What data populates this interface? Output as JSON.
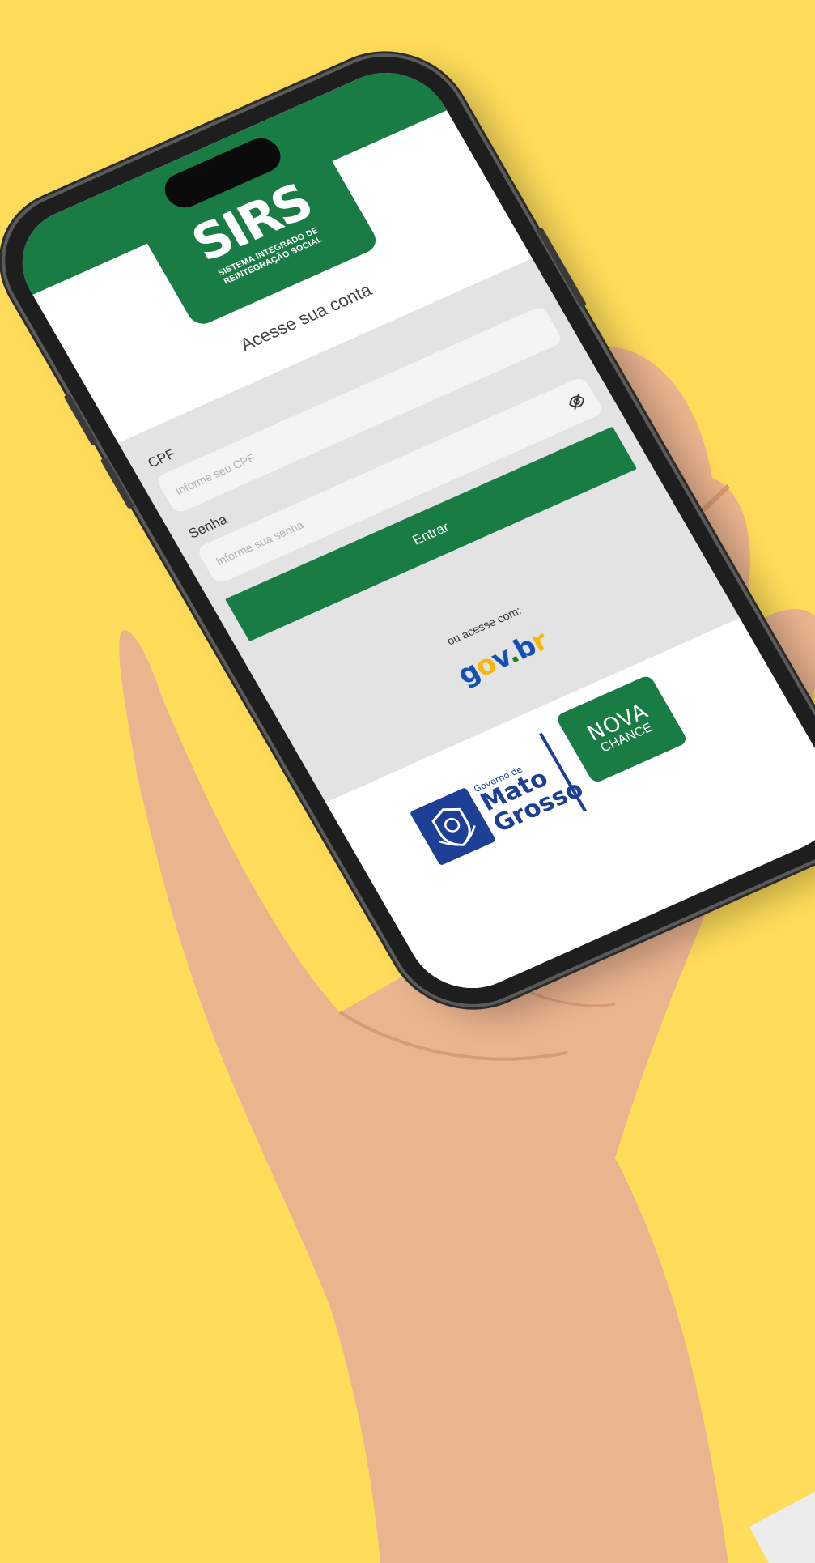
{
  "logo": {
    "wordmark": "SIRS",
    "subtitle_line1": "SISTEMA INTEGRADO DE",
    "subtitle_line2": "REINTEGRAÇÃO SOCIAL"
  },
  "login": {
    "title": "Acesse sua conta",
    "cpf_label": "CPF",
    "cpf_placeholder": "Informe seu CPF",
    "password_label": "Senha",
    "password_placeholder": "Informe sua senha",
    "submit_label": "Entrar",
    "alt_text": "ou acesse com:"
  },
  "govbr": {
    "g": "g",
    "o": "o",
    "v": "v",
    "dot": ".",
    "b": "b",
    "r": "r"
  },
  "partners": {
    "mt_gov_prefix": "Governo de",
    "mt_line1": "Mato",
    "mt_line2": "Grosso",
    "nova_line1": "NOVA",
    "nova_line2": "CHANCE"
  },
  "colors": {
    "background": "#ffdd5a",
    "brand_green": "#1a7c45",
    "form_gray": "#e3e3e3",
    "mt_blue": "#1d3f96",
    "govbr_blue": "#1351b4",
    "govbr_yellow": "#f8b60b"
  },
  "icons": {
    "password_toggle": "eye-off-icon"
  }
}
